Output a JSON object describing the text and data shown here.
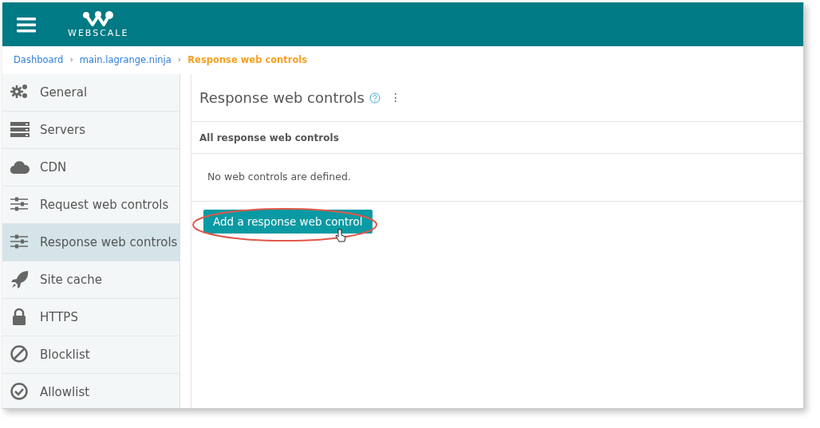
{
  "header": {
    "logo_text": "WEBSCALE"
  },
  "breadcrumb": [
    {
      "label": "Dashboard",
      "current": false
    },
    {
      "label": "main.lagrange.ninja",
      "current": false
    },
    {
      "label": "Response web controls",
      "current": true
    }
  ],
  "breadcrumb_separator": "›",
  "sidebar": {
    "items": [
      {
        "label": "General",
        "selected": false
      },
      {
        "label": "Servers",
        "selected": false
      },
      {
        "label": "CDN",
        "selected": false
      },
      {
        "label": "Request web controls",
        "selected": false
      },
      {
        "label": "Response web controls",
        "selected": true
      },
      {
        "label": "Site cache",
        "selected": false
      },
      {
        "label": "HTTPS",
        "selected": false
      },
      {
        "label": "Blocklist",
        "selected": false
      },
      {
        "label": "Allowlist",
        "selected": false
      }
    ]
  },
  "main": {
    "title": "Response web controls",
    "more_menu": "⋮",
    "section_title": "All response web controls",
    "empty_message": "No web controls are defined.",
    "add_button": {
      "label": "Add a response web control",
      "highlighted": true
    }
  }
}
